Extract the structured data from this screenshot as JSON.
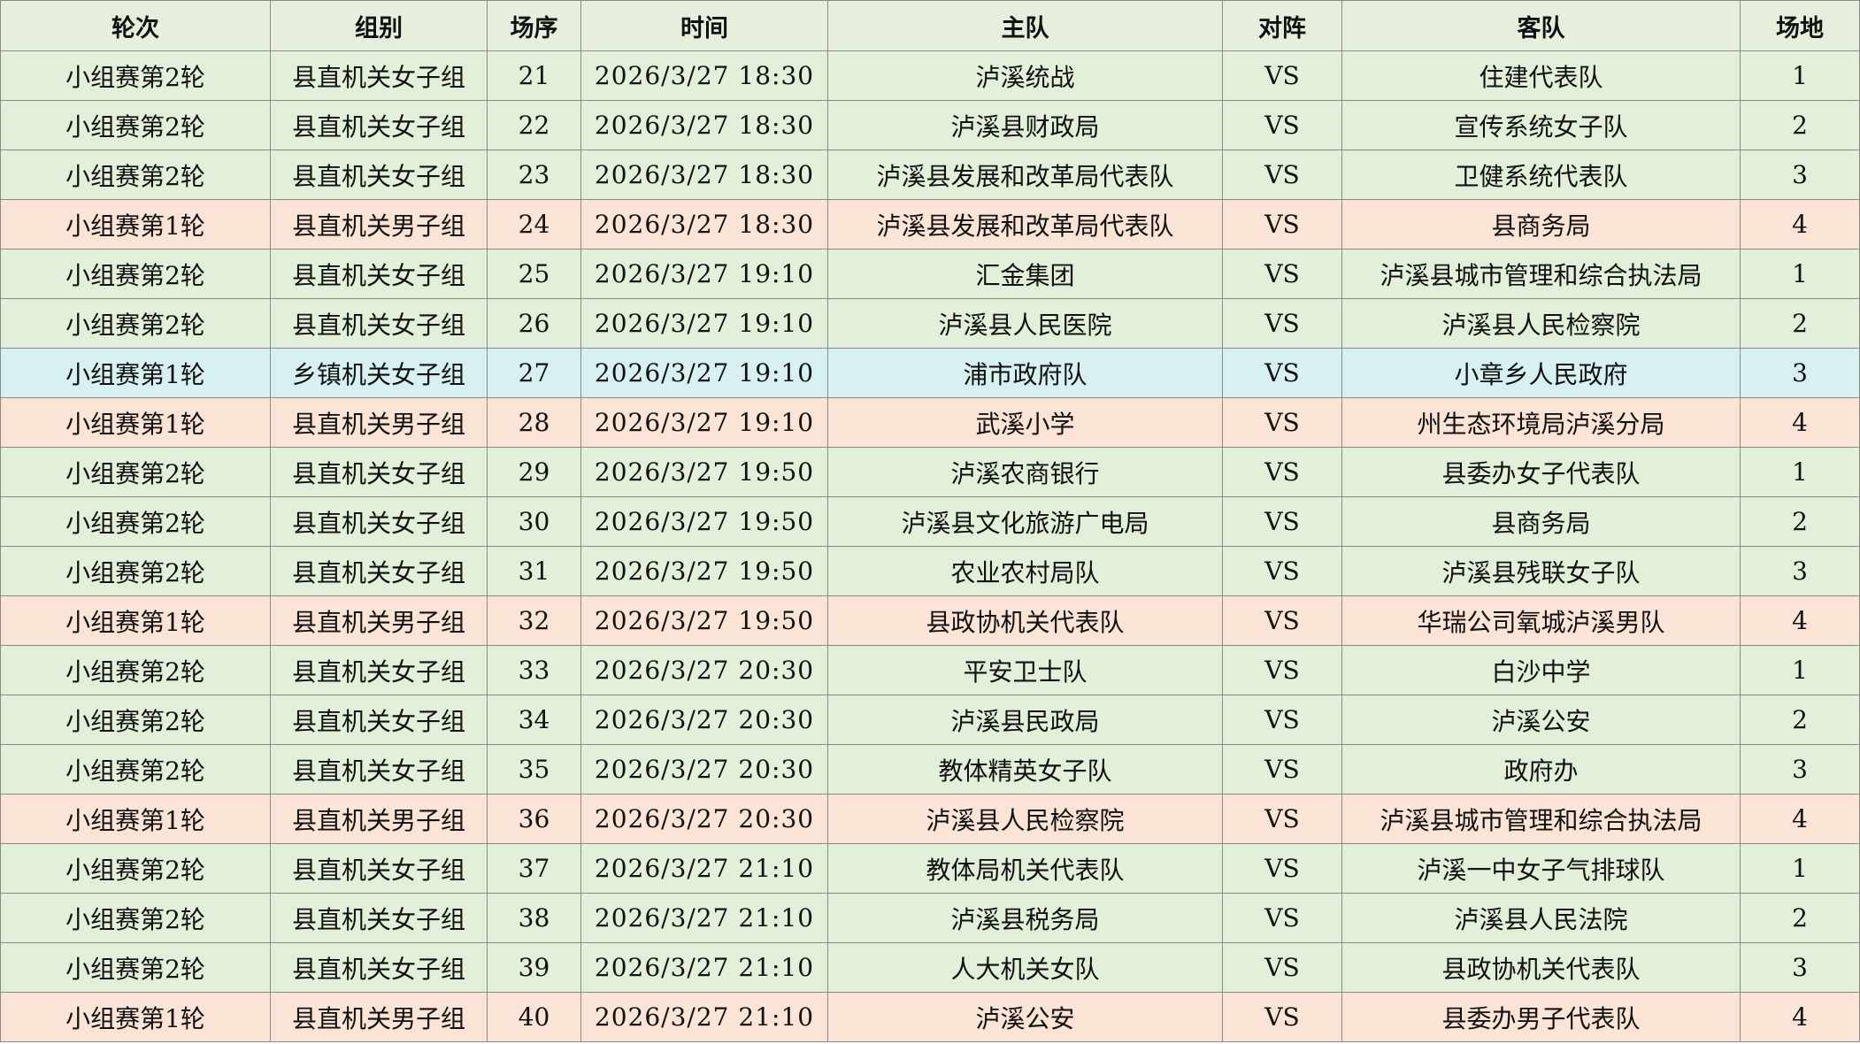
{
  "colors": {
    "header_bg": "#e6efdb",
    "women_county": "#e2efd9",
    "men_county": "#fbe3d5",
    "women_township": "#d7f1f2",
    "grid_line": "#8a8a8a"
  },
  "headers": [
    "轮次",
    "组别",
    "场序",
    "时间",
    "主队",
    "对阵",
    "客队",
    "场地"
  ],
  "rows": [
    {
      "round": "小组赛第2轮",
      "group": "县直机关女子组",
      "seq": "21",
      "time": "2026/3/27  18:30",
      "home": "泸溪统战",
      "vs": "VS",
      "away": "住建代表队",
      "court": "1",
      "row_color": "#e2efd9"
    },
    {
      "round": "小组赛第2轮",
      "group": "县直机关女子组",
      "seq": "22",
      "time": "2026/3/27  18:30",
      "home": "泸溪县财政局",
      "vs": "VS",
      "away": "宣传系统女子队",
      "court": "2",
      "row_color": "#e2efd9"
    },
    {
      "round": "小组赛第2轮",
      "group": "县直机关女子组",
      "seq": "23",
      "time": "2026/3/27  18:30",
      "home": "泸溪县发展和改革局代表队",
      "vs": "VS",
      "away": "卫健系统代表队",
      "court": "3",
      "row_color": "#e2efd9"
    },
    {
      "round": "小组赛第1轮",
      "group": "县直机关男子组",
      "seq": "24",
      "time": "2026/3/27  18:30",
      "home": "泸溪县发展和改革局代表队",
      "vs": "VS",
      "away": "县商务局",
      "court": "4",
      "row_color": "#fbe3d5"
    },
    {
      "round": "小组赛第2轮",
      "group": "县直机关女子组",
      "seq": "25",
      "time": "2026/3/27  19:10",
      "home": "汇金集团",
      "vs": "VS",
      "away": "泸溪县城市管理和综合执法局",
      "court": "1",
      "row_color": "#e2efd9"
    },
    {
      "round": "小组赛第2轮",
      "group": "县直机关女子组",
      "seq": "26",
      "time": "2026/3/27  19:10",
      "home": "泸溪县人民医院",
      "vs": "VS",
      "away": "泸溪县人民检察院",
      "court": "2",
      "row_color": "#e2efd9"
    },
    {
      "round": "小组赛第1轮",
      "group": "乡镇机关女子组",
      "seq": "27",
      "time": "2026/3/27  19:10",
      "home": "浦市政府队",
      "vs": "VS",
      "away": "小章乡人民政府",
      "court": "3",
      "row_color": "#d7f1f2"
    },
    {
      "round": "小组赛第1轮",
      "group": "县直机关男子组",
      "seq": "28",
      "time": "2026/3/27  19:10",
      "home": "武溪小学",
      "vs": "VS",
      "away": "州生态环境局泸溪分局",
      "court": "4",
      "row_color": "#fbe3d5"
    },
    {
      "round": "小组赛第2轮",
      "group": "县直机关女子组",
      "seq": "29",
      "time": "2026/3/27  19:50",
      "home": "泸溪农商银行",
      "vs": "VS",
      "away": "县委办女子代表队",
      "court": "1",
      "row_color": "#e2efd9"
    },
    {
      "round": "小组赛第2轮",
      "group": "县直机关女子组",
      "seq": "30",
      "time": "2026/3/27  19:50",
      "home": "泸溪县文化旅游广电局",
      "vs": "VS",
      "away": "县商务局",
      "court": "2",
      "row_color": "#e2efd9"
    },
    {
      "round": "小组赛第2轮",
      "group": "县直机关女子组",
      "seq": "31",
      "time": "2026/3/27  19:50",
      "home": "农业农村局队",
      "vs": "VS",
      "away": "泸溪县残联女子队",
      "court": "3",
      "row_color": "#e2efd9"
    },
    {
      "round": "小组赛第1轮",
      "group": "县直机关男子组",
      "seq": "32",
      "time": "2026/3/27  19:50",
      "home": "县政协机关代表队",
      "vs": "VS",
      "away": "华瑞公司氧城泸溪男队",
      "court": "4",
      "row_color": "#fbe3d5"
    },
    {
      "round": "小组赛第2轮",
      "group": "县直机关女子组",
      "seq": "33",
      "time": "2026/3/27  20:30",
      "home": "平安卫士队",
      "vs": "VS",
      "away": "白沙中学",
      "court": "1",
      "row_color": "#e2efd9"
    },
    {
      "round": "小组赛第2轮",
      "group": "县直机关女子组",
      "seq": "34",
      "time": "2026/3/27  20:30",
      "home": "泸溪县民政局",
      "vs": "VS",
      "away": "泸溪公安",
      "court": "2",
      "row_color": "#e2efd9"
    },
    {
      "round": "小组赛第2轮",
      "group": "县直机关女子组",
      "seq": "35",
      "time": "2026/3/27  20:30",
      "home": "教体精英女子队",
      "vs": "VS",
      "away": "政府办",
      "court": "3",
      "row_color": "#e2efd9"
    },
    {
      "round": "小组赛第1轮",
      "group": "县直机关男子组",
      "seq": "36",
      "time": "2026/3/27  20:30",
      "home": "泸溪县人民检察院",
      "vs": "VS",
      "away": "泸溪县城市管理和综合执法局",
      "court": "4",
      "row_color": "#fbe3d5"
    },
    {
      "round": "小组赛第2轮",
      "group": "县直机关女子组",
      "seq": "37",
      "time": "2026/3/27  21:10",
      "home": "教体局机关代表队",
      "vs": "VS",
      "away": "泸溪一中女子气排球队",
      "court": "1",
      "row_color": "#e2efd9"
    },
    {
      "round": "小组赛第2轮",
      "group": "县直机关女子组",
      "seq": "38",
      "time": "2026/3/27  21:10",
      "home": "泸溪县税务局",
      "vs": "VS",
      "away": "泸溪县人民法院",
      "court": "2",
      "row_color": "#e2efd9"
    },
    {
      "round": "小组赛第2轮",
      "group": "县直机关女子组",
      "seq": "39",
      "time": "2026/3/27  21:10",
      "home": "人大机关女队",
      "vs": "VS",
      "away": "县政协机关代表队",
      "court": "3",
      "row_color": "#e2efd9"
    },
    {
      "round": "小组赛第1轮",
      "group": "县直机关男子组",
      "seq": "40",
      "time": "2026/3/27  21:10",
      "home": "泸溪公安",
      "vs": "VS",
      "away": "县委办男子代表队",
      "court": "4",
      "row_color": "#fbe3d5"
    }
  ]
}
